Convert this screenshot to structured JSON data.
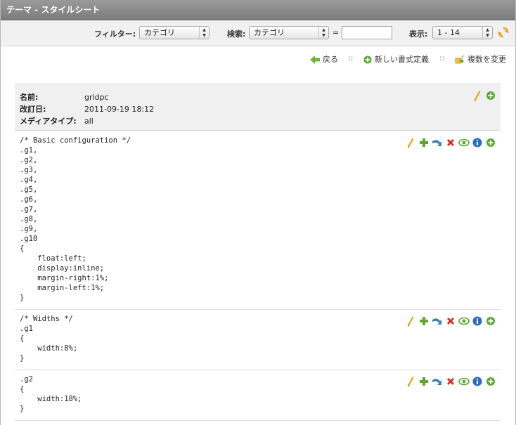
{
  "window": {
    "title": "テーマ - スタイルシート"
  },
  "filter": {
    "filter_label": "フィルター:",
    "filter_value": "カテゴリ",
    "search_label": "検索:",
    "search_field_value": "カテゴリ",
    "equals": "=",
    "search_text": "",
    "display_label": "表示:",
    "display_value": "1 - 14"
  },
  "nav": {
    "back": "戻る",
    "sep": "::",
    "new_format": "新しい書式定義",
    "change_multiple": "複数を変更"
  },
  "info": {
    "name_label": "名前:",
    "name_value": "gridpc",
    "modified_label": "改訂日:",
    "modified_value": "2011-09-19 18:12",
    "media_label": "メディアタイプ:",
    "media_value": "all"
  },
  "rules": [
    {
      "code": "/* Basic configuration */\n.g1,\n.g2,\n.g3,\n.g4,\n.g5,\n.g6,\n.g7,\n.g8,\n.g9,\n.g10\n{\n    float:left;\n    display:inline;\n    margin-right:1%;\n    margin-left:1%;\n}"
    },
    {
      "code": "/* Widths */\n.g1\n{\n    width:8%;\n}"
    },
    {
      "code": ".g2\n{\n    width:18%;\n}"
    }
  ],
  "colors": {
    "title_bar": "#8a8a8a",
    "edit_pencil": "#e3a21a",
    "add_green": "#5aa832",
    "delete_red": "#d0302a",
    "move_blue": "#3a7fb8",
    "info_blue": "#2a6cc1"
  },
  "icons": [
    "edit-pencil-icon",
    "add-plus-icon",
    "move-arrow-icon",
    "delete-x-icon",
    "view-eye-icon",
    "info-icon",
    "add-circle-icon",
    "back-arrow-icon",
    "refresh-icon",
    "multi-edit-icon"
  ]
}
